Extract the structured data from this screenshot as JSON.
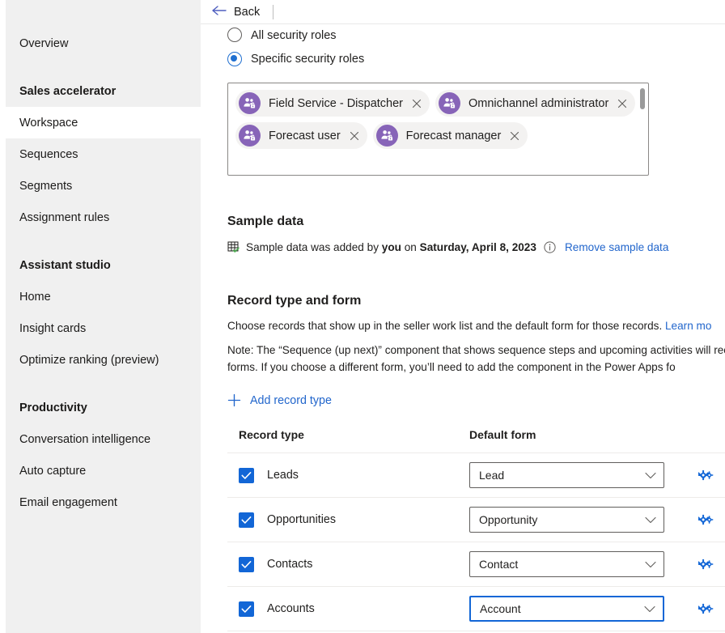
{
  "sidebar": {
    "items": [
      {
        "label": "Overview",
        "type": "item",
        "selected": false
      },
      {
        "label": "Sales accelerator",
        "type": "group",
        "selected": false
      },
      {
        "label": "Workspace",
        "type": "item",
        "selected": true
      },
      {
        "label": "Sequences",
        "type": "item",
        "selected": false
      },
      {
        "label": "Segments",
        "type": "item",
        "selected": false
      },
      {
        "label": "Assignment rules",
        "type": "item",
        "selected": false
      },
      {
        "label": "Assistant studio",
        "type": "group",
        "selected": false
      },
      {
        "label": "Home",
        "type": "item",
        "selected": false
      },
      {
        "label": "Insight cards",
        "type": "item",
        "selected": false
      },
      {
        "label": "Optimize ranking (preview)",
        "type": "item",
        "selected": false
      },
      {
        "label": "Productivity",
        "type": "group",
        "selected": false
      },
      {
        "label": "Conversation intelligence",
        "type": "item",
        "selected": false
      },
      {
        "label": "Auto capture",
        "type": "item",
        "selected": false
      },
      {
        "label": "Email engagement",
        "type": "item",
        "selected": false
      }
    ]
  },
  "topbar": {
    "back_label": "Back",
    "back_icon": "arrow-left-icon"
  },
  "security_roles": {
    "options": [
      {
        "label": "All security roles",
        "selected": false
      },
      {
        "label": "Specific security roles",
        "selected": true
      }
    ],
    "tags": [
      {
        "label": "Field Service - Dispatcher",
        "icon": "security-role-icon",
        "close_icon": "close-icon"
      },
      {
        "label": "Omnichannel administrator",
        "icon": "security-role-icon",
        "close_icon": "close-icon"
      },
      {
        "label": "Forecast user",
        "icon": "security-role-icon",
        "close_icon": "close-icon"
      },
      {
        "label": "Forecast manager",
        "icon": "security-role-icon",
        "close_icon": "close-icon"
      }
    ]
  },
  "sample_data": {
    "heading": "Sample data",
    "icon": "table-check-icon",
    "text_prefix": "Sample data was added by ",
    "text_bold_1": "you",
    "text_middle": " on ",
    "text_bold_2": "Saturday, April 8, 2023",
    "info_icon": "info-icon",
    "remove_link": "Remove sample data"
  },
  "record_type": {
    "heading": "Record type and form",
    "description": "Choose records that show up in the seller work list and the default form for those records. ",
    "description_link": "Learn mo",
    "note": "Note: The “Sequence (up next)” component that shows sequence steps and upcoming activities will  record forms. If you choose a different form, you’ll need to add the component in the Power Apps fo",
    "add_button": "Add record type",
    "add_icon": "plus-icon",
    "columns": [
      "Record type",
      "Default form"
    ],
    "rows": [
      {
        "label": "Leads",
        "checked": true,
        "form": "Lead",
        "focused": false,
        "action_icon": "gear-pair-icon"
      },
      {
        "label": "Opportunities",
        "checked": true,
        "form": "Opportunity",
        "focused": false,
        "action_icon": "gear-pair-icon"
      },
      {
        "label": "Contacts",
        "checked": true,
        "form": "Contact",
        "focused": false,
        "action_icon": "gear-pair-icon"
      },
      {
        "label": "Accounts",
        "checked": true,
        "form": "Account",
        "focused": true,
        "action_icon": "gear-pair-icon"
      }
    ]
  },
  "colors": {
    "accent_blue": "#1266d6",
    "link_blue": "#2266cc",
    "avatar_purple": "#8764b8",
    "sidebar_bg": "#f0f0f0"
  }
}
